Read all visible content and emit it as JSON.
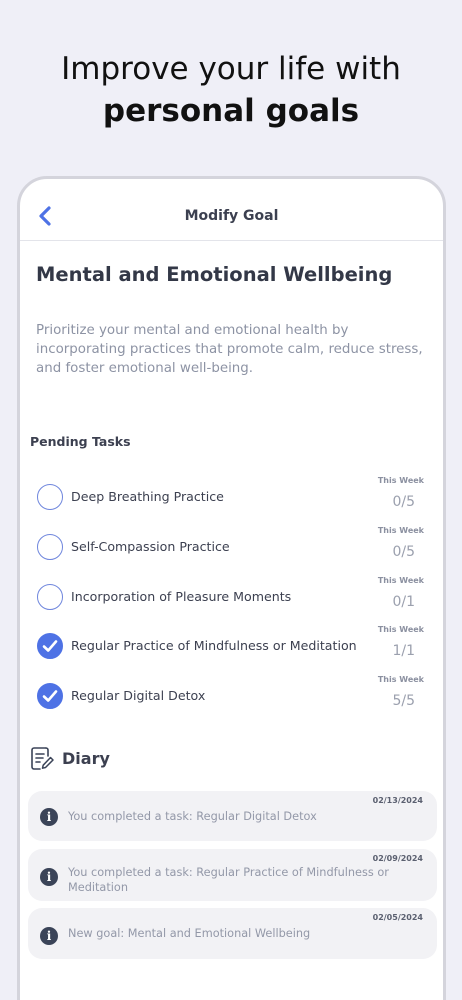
{
  "promo": {
    "line1": "Improve your life with",
    "line2": "personal goals"
  },
  "navbar": {
    "back_icon": "chevron-left-icon",
    "title": "Modify Goal"
  },
  "goal": {
    "title": "Mental and Emotional Wellbeing",
    "description": "Prioritize your mental and emotional health by incorporating practices that promote calm, reduce stress, and foster emotional well-being."
  },
  "pending": {
    "label": "Pending Tasks",
    "tasks": [
      {
        "name": "Deep Breathing Practice",
        "period": "This Week",
        "count": "0/5",
        "done": false
      },
      {
        "name": "Self-Compassion Practice",
        "period": "This Week",
        "count": "0/5",
        "done": false
      },
      {
        "name": "Incorporation of Pleasure Moments",
        "period": "This Week",
        "count": "0/1",
        "done": false
      },
      {
        "name": "Regular Practice of Mindfulness or Meditation",
        "period": "This Week",
        "count": "1/1",
        "done": true
      },
      {
        "name": "Regular Digital Detox",
        "period": "This Week",
        "count": "5/5",
        "done": true
      }
    ]
  },
  "diary": {
    "label": "Diary",
    "icon": "notebook-edit-icon",
    "entries": [
      {
        "date": "02/13/2024",
        "text": "You completed a task: Regular Digital Detox"
      },
      {
        "date": "02/09/2024",
        "text": "You completed a task: Regular Practice of Mindfulness or Meditation"
      },
      {
        "date": "02/05/2024",
        "text": "New goal: Mental and Emotional Wellbeing"
      }
    ]
  },
  "colors": {
    "accent": "#4e72e5",
    "background": "#efeff7",
    "entry_bg": "#f2f2f5"
  }
}
